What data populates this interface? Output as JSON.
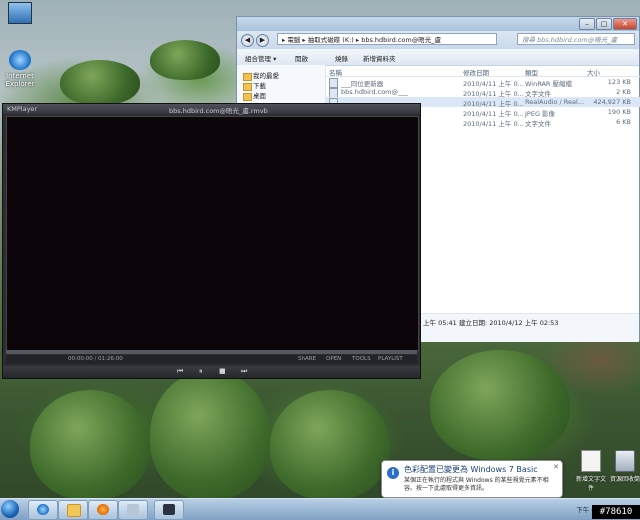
{
  "desktop": {
    "icons": [
      {
        "label": ""
      },
      {
        "label": "Internet Explorer"
      }
    ],
    "right_icons": [
      {
        "label": "新增文字文件"
      },
      {
        "label": "資源回收筒"
      }
    ]
  },
  "explorer": {
    "breadcrumb": "▸ 電腦 ▸ 抽取式磁碟 (K:) ▸ bbs.hdbird.com@晤光_盧",
    "search_placeholder": "搜尋 bbs.hdbird.com@晤光_盧",
    "toolbar": [
      "組合管理 ▾",
      "開啟",
      "燒錄",
      "新增資料夾"
    ],
    "nav": [
      "我的最愛",
      "下載",
      "桌面"
    ],
    "columns": [
      "名稱",
      "修改日期",
      "類型",
      "大小"
    ],
    "files": [
      {
        "name": "___同位更新器",
        "date": "2010/4/11 上午 0...",
        "type": "WinRAR 壓縮檔",
        "size": "123 KB"
      },
      {
        "name": "bbs.hdbird.com@___",
        "date": "2010/4/11 上午 0...",
        "type": "文字文件",
        "size": "2 KB"
      },
      {
        "name": "",
        "date": "2010/4/11 上午 0...",
        "type": "RealAudio / Real...",
        "size": "424,927 KB"
      },
      {
        "name": "",
        "date": "2010/4/11 上午 0...",
        "type": "JPEG 影像",
        "size": "190 KB"
      },
      {
        "name": "",
        "date": "2010/4/11 上午 0...",
        "type": "文字文件",
        "size": "6 KB"
      }
    ],
    "status_modified": "上午 05:41",
    "status_created": "建立日期: 2010/4/12 上午 02:53"
  },
  "player": {
    "app": "KMPlayer",
    "title": "bbs.hdbird.com@晤光_盧.rmvb",
    "time": "00:00:00 / 01:26:00",
    "ctrl_labels": [
      "ShARE",
      "OPEN",
      "TOOLS",
      "PLAYLIST"
    ],
    "buttons": [
      "⏮",
      "⏸",
      "■",
      "⏭"
    ]
  },
  "balloon": {
    "title": "色彩配置已變更為 Windows 7 Basic",
    "body": "某個正在執行的程式與 Windows 的某些視覺元素不相容。按一下此處取得更多資訊。",
    "close": "✕"
  },
  "taskbar": {
    "clock": "下午 05:05"
  },
  "watermark": "#78610"
}
